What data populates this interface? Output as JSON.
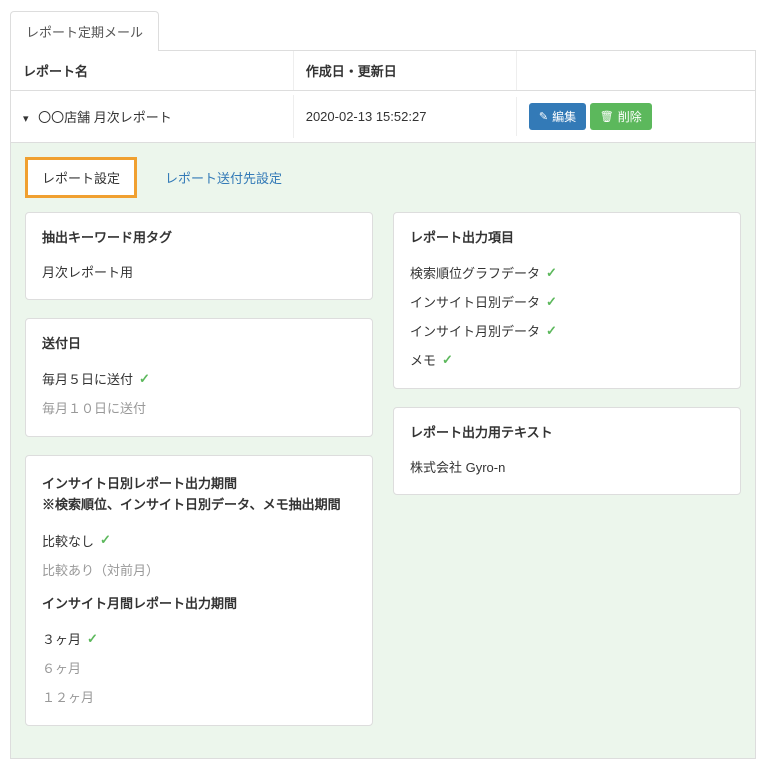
{
  "tabs": {
    "main": "レポート定期メール"
  },
  "table": {
    "headers": {
      "name": "レポート名",
      "date": "作成日・更新日"
    },
    "row": {
      "name": "〇〇店舗 月次レポート",
      "date": "2020-02-13 15:52:27"
    },
    "buttons": {
      "edit": "編集",
      "delete": "削除"
    }
  },
  "subTabs": {
    "settings": "レポート設定",
    "recipients": "レポート送付先設定"
  },
  "cards": {
    "keywords": {
      "title": "抽出キーワード用タグ",
      "value": "月次レポート用"
    },
    "sendDay": {
      "title": "送付日",
      "opt1": "毎月５日に送付",
      "opt2": "毎月１０日に送付"
    },
    "insightPeriod": {
      "title1": "インサイト日別レポート出力期間",
      "title2": "※検索順位、インサイト日別データ、メモ抽出期間",
      "opt1": "比較なし",
      "opt2": "比較あり（対前月）",
      "title3": "インサイト月間レポート出力期間",
      "opt3": "３ヶ月",
      "opt4": "６ヶ月",
      "opt5": "１２ヶ月"
    },
    "outputItems": {
      "title": "レポート出力項目",
      "item1": "検索順位グラフデータ",
      "item2": "インサイト日別データ",
      "item3": "インサイト月別データ",
      "item4": "メモ"
    },
    "outputText": {
      "title": "レポート出力用テキスト",
      "value": "株式会社 Gyro-n"
    }
  }
}
